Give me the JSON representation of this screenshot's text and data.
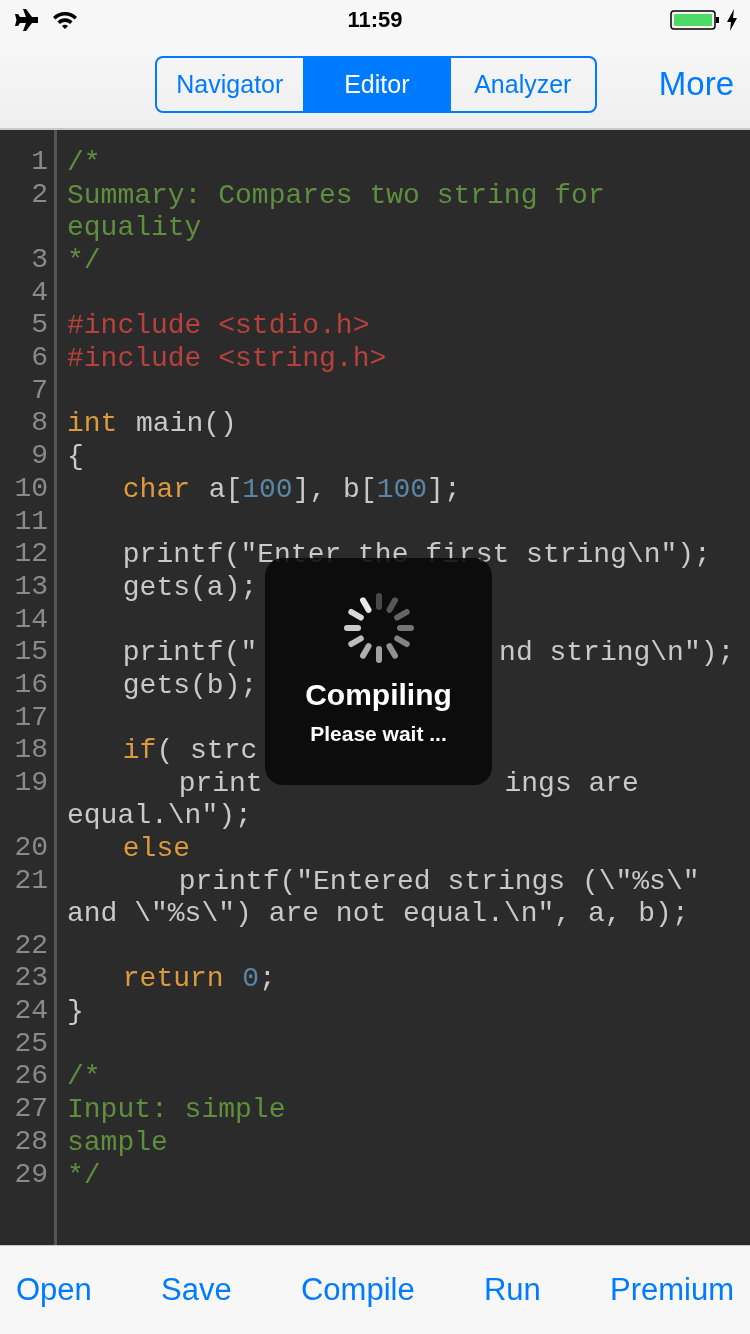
{
  "status_bar": {
    "time": "11:59"
  },
  "nav": {
    "segments": [
      {
        "label": "Navigator",
        "selected": false
      },
      {
        "label": "Editor",
        "selected": true
      },
      {
        "label": "Analyzer",
        "selected": false
      }
    ],
    "more": "More"
  },
  "code": [
    {
      "number": "1",
      "tokens": [
        {
          "kind": "comment",
          "text": "/*"
        }
      ]
    },
    {
      "number": "2",
      "tokens": [
        {
          "kind": "comment",
          "text": "Summary: Compares two string for equality"
        }
      ]
    },
    {
      "number": "3",
      "tokens": [
        {
          "kind": "comment",
          "text": "*/"
        }
      ]
    },
    {
      "number": "4"
    },
    {
      "number": "5",
      "tokens": [
        {
          "kind": "preprocessor",
          "text": "#include <stdio.h>"
        }
      ]
    },
    {
      "number": "6",
      "tokens": [
        {
          "kind": "preprocessor",
          "text": "#include <string.h>"
        }
      ]
    },
    {
      "number": "7"
    },
    {
      "number": "8",
      "tokens": [
        {
          "kind": "keyword",
          "text": "int"
        },
        {
          "kind": "plain",
          "text": " main()"
        }
      ]
    },
    {
      "number": "9",
      "tokens": [
        {
          "kind": "plain",
          "text": "{"
        }
      ]
    },
    {
      "number": "10",
      "tokens": [
        {
          "kind": "keyword",
          "text": "   char"
        },
        {
          "kind": "plain",
          "text": " a["
        },
        {
          "kind": "number",
          "text": "100"
        },
        {
          "kind": "plain",
          "text": "], b["
        },
        {
          "kind": "number",
          "text": "100"
        },
        {
          "kind": "plain",
          "text": "];"
        }
      ]
    },
    {
      "number": "11"
    },
    {
      "number": "12",
      "tokens": [
        {
          "kind": "plain",
          "text": "   printf(\"Enter the first string\\n\");"
        }
      ]
    },
    {
      "number": "13",
      "tokens": [
        {
          "kind": "plain",
          "text": "   gets(a);"
        }
      ]
    },
    {
      "number": "14"
    },
    {
      "number": "15",
      "tokens": [
        {
          "kind": "plain",
          "text": "   printf(\""
        },
        {
          "kind": "plain",
          "text": "             nd string\\n\");"
        }
      ]
    },
    {
      "number": "16",
      "tokens": [
        {
          "kind": "plain",
          "text": "   gets(b);"
        }
      ]
    },
    {
      "number": "17"
    },
    {
      "number": "18",
      "tokens": [
        {
          "kind": "keyword",
          "text": "   if"
        },
        {
          "kind": "plain",
          "text": "( strc"
        }
      ]
    },
    {
      "number": "19",
      "tokens": [
        {
          "kind": "plain",
          "text": "      print"
        },
        {
          "kind": "plain",
          "text": "             ings are"
        },
        {
          "kind": "plain",
          "text": " equal.\\n\");"
        }
      ]
    },
    {
      "number": "20",
      "tokens": [
        {
          "kind": "keyword",
          "text": "   else"
        }
      ]
    },
    {
      "number": "21",
      "tokens": [
        {
          "kind": "plain",
          "text": "      printf(\"Entered strings (\\\"%s\\\" and \\\"%s\\\") are not equal.\\n\", a, b);"
        }
      ]
    },
    {
      "number": "22"
    },
    {
      "number": "23",
      "tokens": [
        {
          "kind": "keyword",
          "text": "   return"
        },
        {
          "kind": "number",
          "text": " 0"
        },
        {
          "kind": "plain",
          "text": ";"
        }
      ]
    },
    {
      "number": "24",
      "tokens": [
        {
          "kind": "plain",
          "text": "}"
        }
      ]
    },
    {
      "number": "25"
    },
    {
      "number": "26",
      "tokens": [
        {
          "kind": "comment",
          "text": "/*"
        }
      ]
    },
    {
      "number": "27",
      "tokens": [
        {
          "kind": "comment",
          "text": "Input: simple"
        }
      ]
    },
    {
      "number": "28",
      "tokens": [
        {
          "kind": "comment",
          "text": "sample"
        }
      ]
    },
    {
      "number": "29",
      "tokens": [
        {
          "kind": "comment",
          "text": "*/"
        }
      ]
    }
  ],
  "overlay": {
    "title": "Compiling",
    "message": "Please wait ..."
  },
  "toolbar": [
    "Open",
    "Save",
    "Compile",
    "Run",
    "Premium"
  ]
}
